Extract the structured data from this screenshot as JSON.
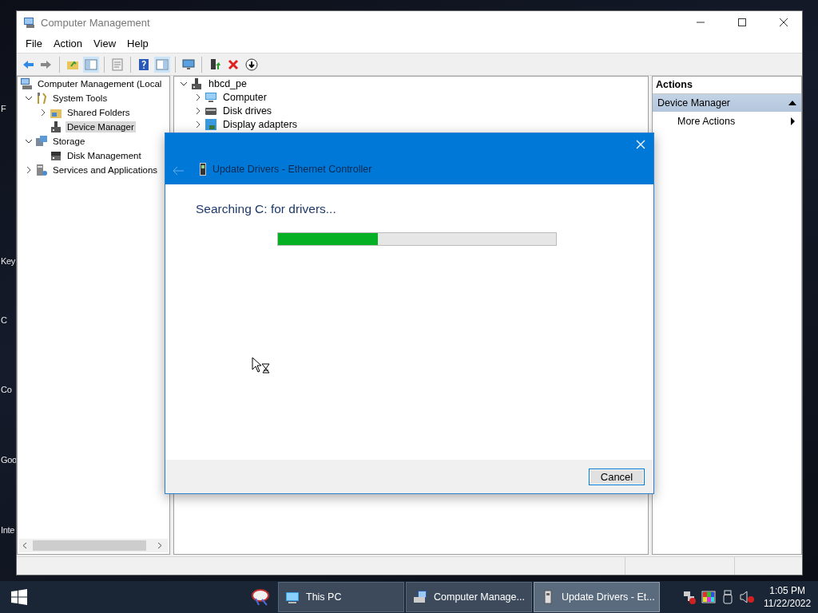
{
  "desktop": {
    "icon_labels": [
      "F",
      "Key",
      "C",
      "Co",
      "Goo",
      "Inte"
    ]
  },
  "window": {
    "title": "Computer Management",
    "menu": [
      "File",
      "Action",
      "View",
      "Help"
    ]
  },
  "nav_tree": [
    {
      "label": "Computer Management (Local",
      "selected": false,
      "children": [
        {
          "label": "System Tools",
          "expanded": true,
          "selected": false,
          "children": [
            {
              "label": "Shared Folders",
              "expanded": false,
              "selected": false
            },
            {
              "label": "Device Manager",
              "selected": true
            }
          ]
        },
        {
          "label": "Storage",
          "expanded": true,
          "selected": false,
          "children": [
            {
              "label": "Disk Management",
              "selected": false
            }
          ]
        },
        {
          "label": "Services and Applications",
          "expanded": false,
          "selected": false
        }
      ]
    }
  ],
  "device_tree": [
    {
      "label": "hbcd_pe",
      "expanded": true,
      "children": [
        {
          "label": "Computer",
          "expanded": false
        },
        {
          "label": "Disk drives",
          "expanded": false
        },
        {
          "label": "Display adapters",
          "expanded": false
        }
      ]
    }
  ],
  "actions": {
    "title": "Actions",
    "groups": [
      {
        "label": "Device Manager",
        "expanded": true,
        "items": [
          "More Actions"
        ]
      }
    ]
  },
  "dialog": {
    "title": "Update Drivers - Ethernet Controller",
    "message": "Searching C: for drivers...",
    "progress": {
      "level": 0.36
    },
    "buttons": [
      "Cancel"
    ]
  },
  "taskbar": {
    "buttons": [
      {
        "label": "This PC",
        "selected": false
      },
      {
        "label": "Computer Manage...",
        "selected": false
      },
      {
        "label": "Update Drivers - Et...",
        "selected": true
      }
    ],
    "clock": {
      "time": "1:05 PM",
      "date": "11/22/2022"
    }
  }
}
